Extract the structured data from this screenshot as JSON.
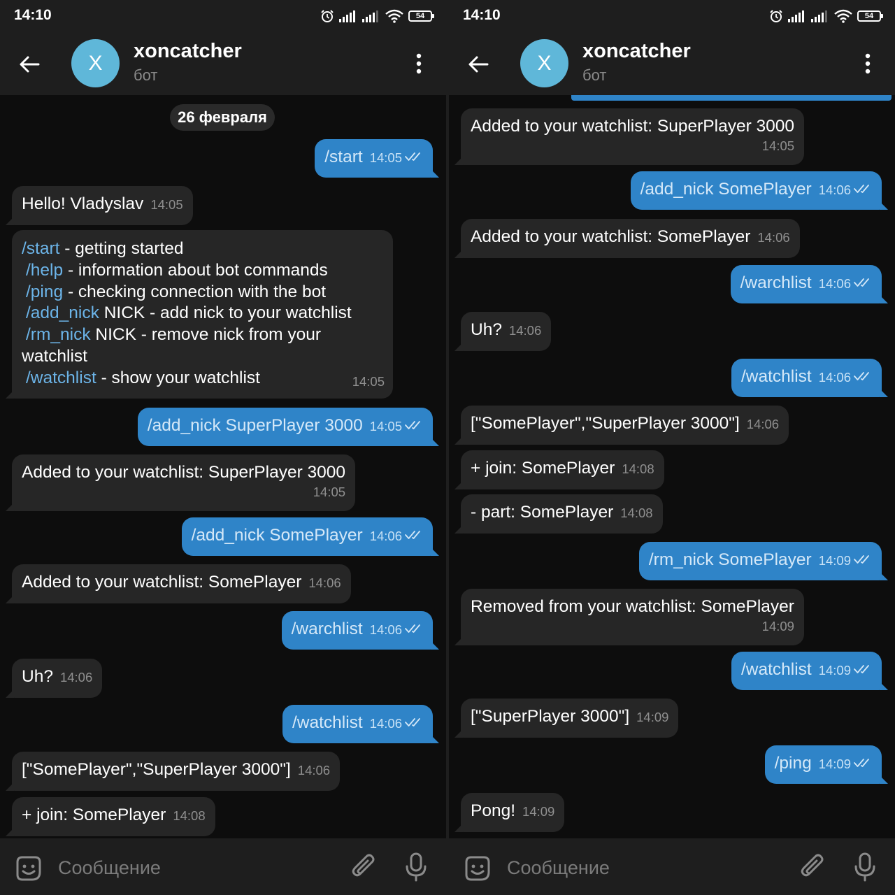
{
  "status": {
    "time": "14:10",
    "battery": "54"
  },
  "header": {
    "avatar_letter": "X",
    "title": "xoncatcher",
    "subtitle": "бот"
  },
  "date": "26 февраля",
  "composer": {
    "placeholder": "Сообщение"
  },
  "help": {
    "lines": [
      {
        "cmd": "/start",
        "rest": " - getting started"
      },
      {
        "cmd": "/help",
        "rest": " - information about bot commands"
      },
      {
        "cmd": "/ping",
        "rest": " - checking connection with the bot"
      },
      {
        "cmd": "/add_nick",
        "rest": " NICK - add nick to your watchlist"
      },
      {
        "cmd": "/rm_nick",
        "rest": " NICK - remove nick from your"
      },
      {
        "cmd": "",
        "rest": "watchlist"
      },
      {
        "cmd": "/watchlist",
        "rest": " - show your watchlist"
      }
    ],
    "time": "14:05"
  },
  "left_messages": [
    {
      "dir": "out",
      "text": "/start",
      "time": "14:05"
    },
    {
      "dir": "in",
      "text": "Hello! Vladyslav",
      "time": "14:05"
    },
    {
      "dir": "out",
      "text": "/add_nick SuperPlayer 3000",
      "time": "14:05"
    },
    {
      "dir": "in",
      "text": "Added to your watchlist: SuperPlayer 3000",
      "time": "14:05"
    },
    {
      "dir": "out",
      "text": "/add_nick SomePlayer",
      "time": "14:06"
    },
    {
      "dir": "in",
      "text": "Added to your watchlist: SomePlayer",
      "time": "14:06"
    },
    {
      "dir": "out",
      "text": "/warchlist",
      "time": "14:06"
    },
    {
      "dir": "in",
      "text": "Uh?",
      "time": "14:06"
    },
    {
      "dir": "out",
      "text": "/watchlist",
      "time": "14:06"
    },
    {
      "dir": "in",
      "text": "[\"SomePlayer\",\"SuperPlayer 3000\"]",
      "time": "14:06"
    },
    {
      "dir": "in",
      "text": "+ join: SomePlayer",
      "time": "14:08"
    }
  ],
  "right_messages": [
    {
      "dir": "in",
      "text": "Added to your watchlist: SuperPlayer 3000",
      "time": "14:05"
    },
    {
      "dir": "out",
      "text": "/add_nick SomePlayer",
      "time": "14:06"
    },
    {
      "dir": "in",
      "text": "Added to your watchlist: SomePlayer",
      "time": "14:06"
    },
    {
      "dir": "out",
      "text": "/warchlist",
      "time": "14:06"
    },
    {
      "dir": "in",
      "text": "Uh?",
      "time": "14:06"
    },
    {
      "dir": "out",
      "text": "/watchlist",
      "time": "14:06"
    },
    {
      "dir": "in",
      "text": "[\"SomePlayer\",\"SuperPlayer 3000\"]",
      "time": "14:06"
    },
    {
      "dir": "in",
      "text": "+ join: SomePlayer",
      "time": "14:08"
    },
    {
      "dir": "in",
      "text": "- part: SomePlayer",
      "time": "14:08"
    },
    {
      "dir": "out",
      "text": "/rm_nick SomePlayer",
      "time": "14:09"
    },
    {
      "dir": "in",
      "text": "Removed from your watchlist: SomePlayer",
      "time": "14:09"
    },
    {
      "dir": "out",
      "text": "/watchlist",
      "time": "14:09"
    },
    {
      "dir": "in",
      "text": "[\"SuperPlayer 3000\"]",
      "time": "14:09"
    },
    {
      "dir": "out",
      "text": "/ping",
      "time": "14:09"
    },
    {
      "dir": "in",
      "text": "Pong!",
      "time": "14:09"
    }
  ],
  "colors": {
    "accent": "#2f84c8",
    "avatar": "#5fb7d9",
    "incoming": "#262626",
    "bar": "#1e1e1e",
    "link": "#6cb4e8"
  },
  "icons": [
    "back-arrow-icon",
    "more-vert-icon",
    "sticker-icon",
    "paperclip-icon",
    "microphone-icon",
    "alarm-icon",
    "signal-icon",
    "wifi-icon",
    "battery-icon",
    "double-check-icon"
  ]
}
